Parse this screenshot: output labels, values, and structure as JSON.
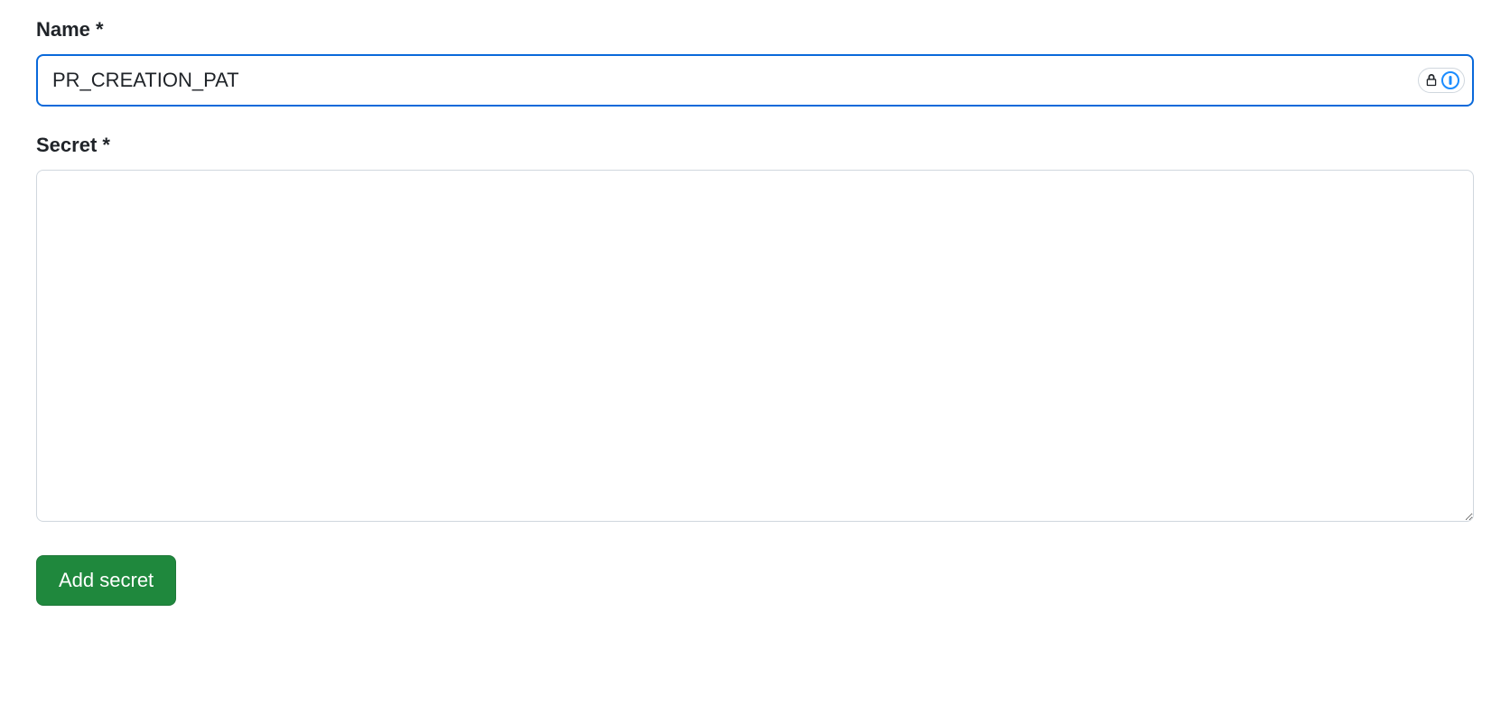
{
  "form": {
    "name": {
      "label": "Name *",
      "value": "PR_CREATION_PAT"
    },
    "secret": {
      "label": "Secret *",
      "value": ""
    },
    "submit_label": "Add secret"
  }
}
